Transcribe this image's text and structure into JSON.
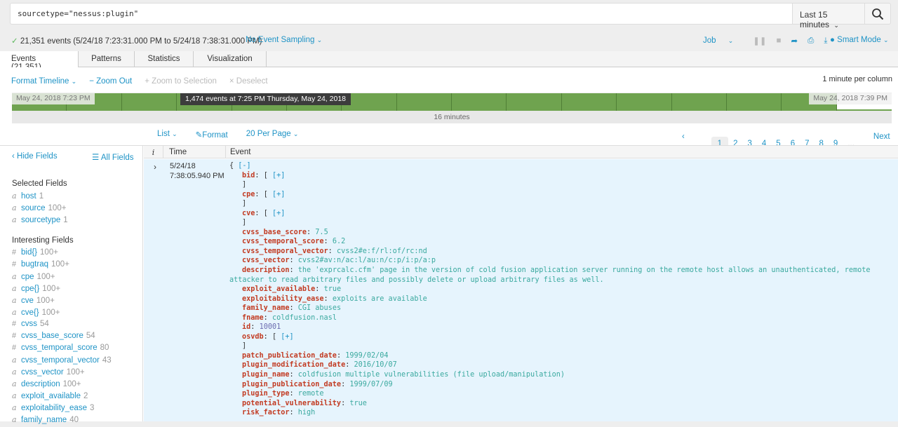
{
  "search": {
    "query": "sourcetype=\"nessus:plugin\"",
    "time_range": "Last 15 minutes",
    "search_icon": "magnifier-icon"
  },
  "status": {
    "summary": "21,351 events (5/24/18 7:23:31.000 PM to 5/24/18 7:38:31.000 PM)",
    "sampling": "No Event Sampling",
    "job": "Job",
    "smart_mode": "Smart Mode"
  },
  "tabs": [
    {
      "label": "Events (21,351)",
      "active": true
    },
    {
      "label": "Patterns"
    },
    {
      "label": "Statistics"
    },
    {
      "label": "Visualization"
    }
  ],
  "timeline": {
    "format": "Format Timeline",
    "zoom_out": "Zoom Out",
    "zoom_selection": "Zoom to Selection",
    "deselect": "Deselect",
    "per_column": "1 minute per column",
    "start_label": "May 24, 2018 7:23 PM",
    "end_label": "May 24, 2018 7:39 PM",
    "tooltip": "1,474 events at 7:25 PM Thursday, May 24, 2018",
    "span_label": "16 minutes",
    "columns": 16,
    "bar_fill": [
      1,
      1,
      1,
      1,
      1,
      1,
      1,
      1,
      1,
      1,
      1,
      1,
      1,
      1,
      1,
      0.08
    ],
    "bar_color": "#6fa34f"
  },
  "list_toolbar": {
    "list": "List",
    "format": "Format",
    "per_page": "20 Per Page"
  },
  "pager": {
    "prev": "Prev",
    "pages": [
      "1",
      "2",
      "3",
      "4",
      "5",
      "6",
      "7",
      "8",
      "9"
    ],
    "current": "1",
    "ellipsis": "...",
    "next": "Next"
  },
  "sidebar": {
    "hide_fields": "Hide Fields",
    "all_fields": "All Fields",
    "selected_title": "Selected Fields",
    "selected": [
      {
        "type": "a",
        "name": "host",
        "count": "1"
      },
      {
        "type": "a",
        "name": "source",
        "count": "100+"
      },
      {
        "type": "a",
        "name": "sourcetype",
        "count": "1"
      }
    ],
    "interesting_title": "Interesting Fields",
    "interesting": [
      {
        "type": "#",
        "name": "bid{}",
        "count": "100+"
      },
      {
        "type": "#",
        "name": "bugtraq",
        "count": "100+"
      },
      {
        "type": "a",
        "name": "cpe",
        "count": "100+"
      },
      {
        "type": "a",
        "name": "cpe{}",
        "count": "100+"
      },
      {
        "type": "a",
        "name": "cve",
        "count": "100+"
      },
      {
        "type": "a",
        "name": "cve{}",
        "count": "100+"
      },
      {
        "type": "#",
        "name": "cvss",
        "count": "54"
      },
      {
        "type": "#",
        "name": "cvss_base_score",
        "count": "54"
      },
      {
        "type": "#",
        "name": "cvss_temporal_score",
        "count": "80"
      },
      {
        "type": "a",
        "name": "cvss_temporal_vector",
        "count": "43"
      },
      {
        "type": "a",
        "name": "cvss_vector",
        "count": "100+"
      },
      {
        "type": "a",
        "name": "description",
        "count": "100+"
      },
      {
        "type": "a",
        "name": "exploit_available",
        "count": "2"
      },
      {
        "type": "a",
        "name": "exploitability_ease",
        "count": "3"
      },
      {
        "type": "a",
        "name": "family_name",
        "count": "40"
      }
    ]
  },
  "events_table": {
    "col_i": "i",
    "col_time": "Time",
    "col_event": "Event",
    "row": {
      "date": "5/24/18",
      "time": "7:38:05.940 PM",
      "open": "{",
      "collapse": "[-]",
      "fields": [
        {
          "key": "bid",
          "array": true
        },
        {
          "key": "cpe",
          "array": true
        },
        {
          "key": "cve",
          "array": true
        },
        {
          "key": "cvss_base_score",
          "value": "7.5"
        },
        {
          "key": "cvss_temporal_score",
          "value": "6.2"
        },
        {
          "key": "cvss_temporal_vector",
          "value": "cvss2#e:f/rl:of/rc:nd"
        },
        {
          "key": "cvss_vector",
          "value": "cvss2#av:n/ac:l/au:n/c:p/i:p/a:p"
        },
        {
          "key": "description",
          "value": "the 'exprcalc.cfm' page in the version of cold fusion application server running on the remote host allows an unauthenticated, remote attacker to read arbitrary files and possibly delete or upload arbitrary files as well."
        },
        {
          "key": "exploit_available",
          "value": "true"
        },
        {
          "key": "exploitability_ease",
          "value": "exploits are available"
        },
        {
          "key": "family_name",
          "value": "CGI abuses"
        },
        {
          "key": "fname",
          "value": "coldfusion.nasl"
        },
        {
          "key": "id",
          "value": "10001",
          "numeric": true
        },
        {
          "key": "osvdb",
          "array": true
        },
        {
          "key": "patch_publication_date",
          "value": "1999/02/04"
        },
        {
          "key": "plugin_modification_date",
          "value": "2016/10/07"
        },
        {
          "key": "plugin_name",
          "value": "coldfusion multiple vulnerabilities (file upload/manipulation)"
        },
        {
          "key": "plugin_publication_date",
          "value": "1999/07/09"
        },
        {
          "key": "plugin_type",
          "value": "remote"
        },
        {
          "key": "potential_vulnerability",
          "value": "true"
        },
        {
          "key": "risk_factor",
          "value": "high"
        }
      ]
    }
  }
}
